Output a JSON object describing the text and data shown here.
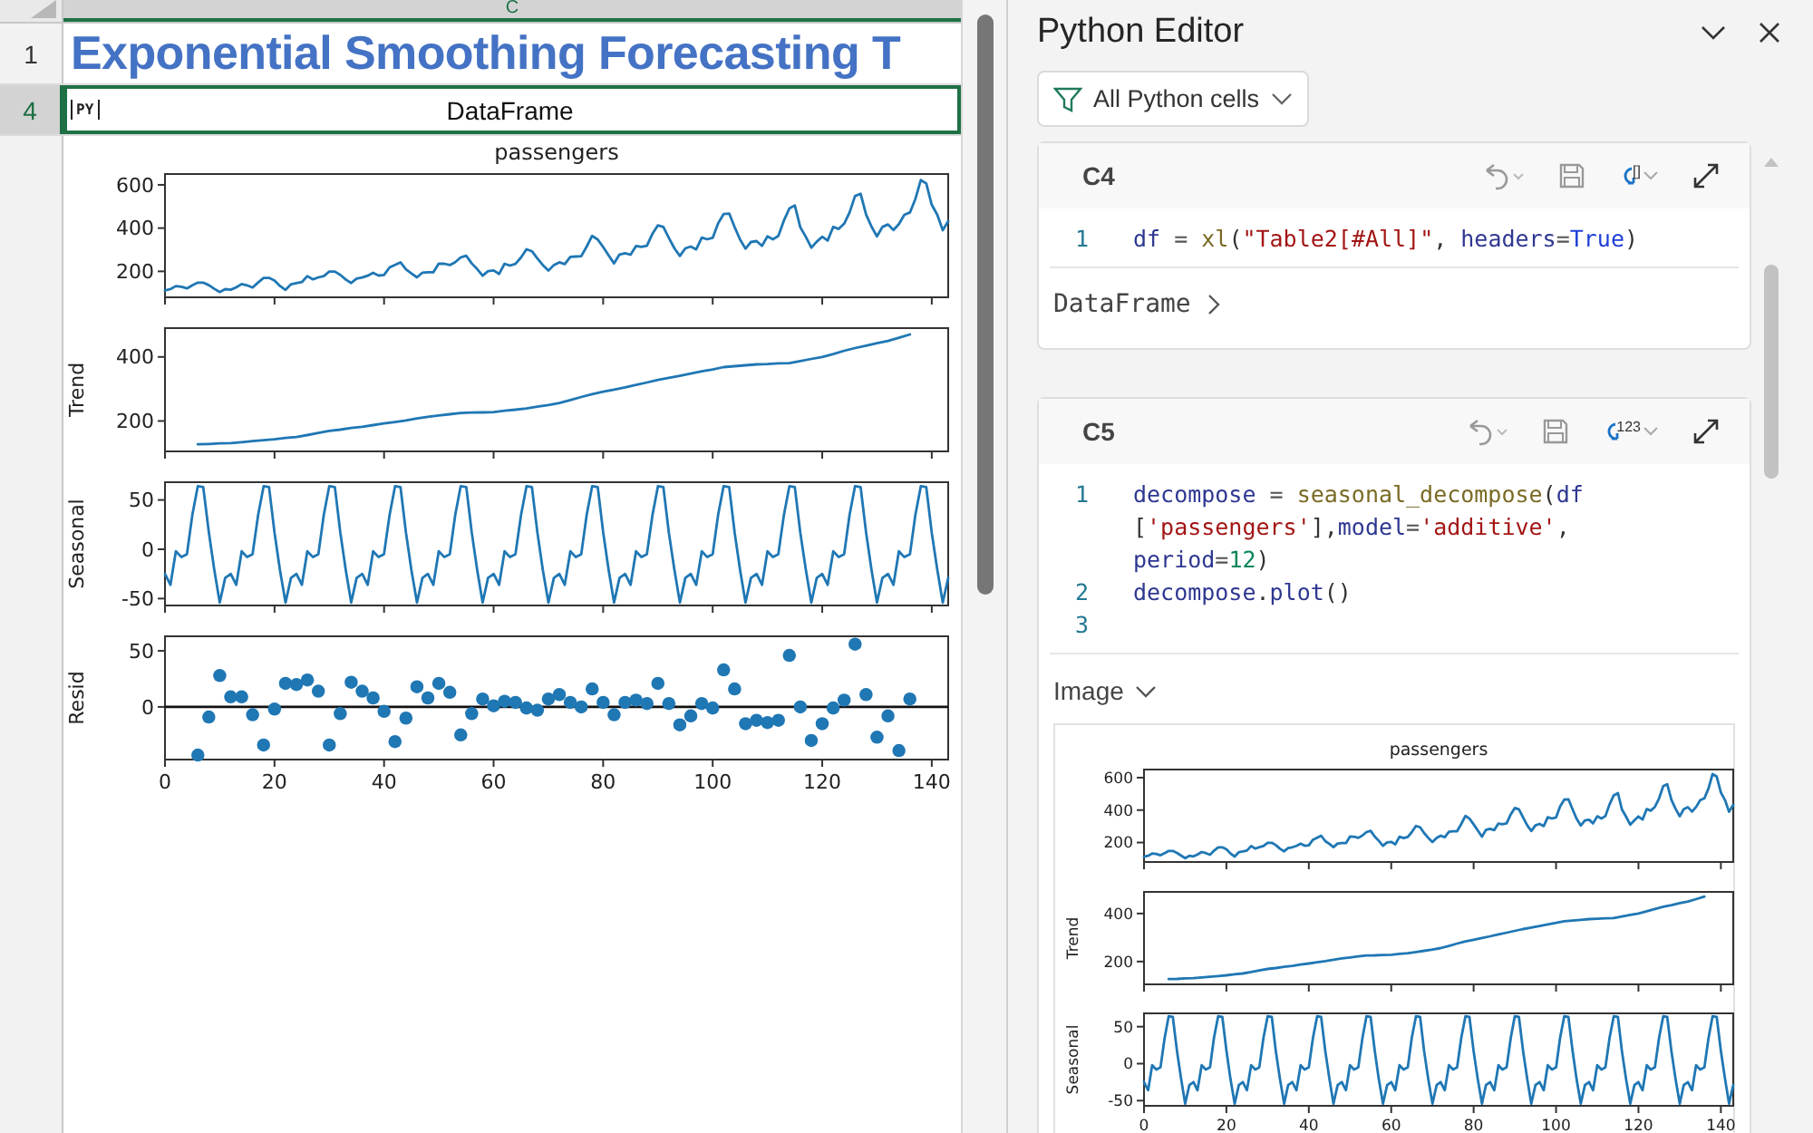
{
  "sheet": {
    "column_header": {
      "label": "C",
      "selected": true
    },
    "rows": [
      {
        "number": "1",
        "selected": false,
        "kind": "title",
        "text": "Exponential Smoothing Forecasting T"
      },
      {
        "number": "4",
        "selected": true,
        "kind": "python",
        "badge": "PY",
        "text": "DataFrame"
      }
    ],
    "plot": [
      {
        "chart_data": {
          "type": "line",
          "title": "passengers",
          "x": [
            0,
            1,
            2,
            3,
            4,
            5,
            6,
            7,
            8,
            9,
            10,
            11,
            12,
            13,
            14,
            15,
            16,
            17,
            18,
            19,
            20,
            21,
            22,
            23,
            24,
            25,
            26,
            27,
            28,
            29,
            30,
            31,
            32,
            33,
            34,
            35,
            36,
            37,
            38,
            39,
            40,
            41,
            42,
            43,
            44,
            45,
            46,
            47,
            48,
            49,
            50,
            51,
            52,
            53,
            54,
            55,
            56,
            57,
            58,
            59,
            60,
            61,
            62,
            63,
            64,
            65,
            66,
            67,
            68,
            69,
            70,
            71,
            72,
            73,
            74,
            75,
            76,
            77,
            78,
            79,
            80,
            81,
            82,
            83,
            84,
            85,
            86,
            87,
            88,
            89,
            90,
            91,
            92,
            93,
            94,
            95,
            96,
            97,
            98,
            99,
            100,
            101,
            102,
            103,
            104,
            105,
            106,
            107,
            108,
            109,
            110,
            111,
            112,
            113,
            114,
            115,
            116,
            117,
            118,
            119,
            120,
            121,
            122,
            123,
            124,
            125,
            126,
            127,
            128,
            129,
            130,
            131,
            132,
            133,
            134,
            135,
            136,
            137,
            138,
            139,
            140,
            141,
            142,
            143
          ],
          "values": [
            112,
            118,
            132,
            129,
            121,
            135,
            148,
            148,
            136,
            119,
            104,
            118,
            115,
            126,
            141,
            135,
            125,
            149,
            170,
            170,
            158,
            133,
            114,
            140,
            145,
            150,
            178,
            163,
            172,
            178,
            199,
            199,
            184,
            162,
            146,
            166,
            171,
            180,
            193,
            181,
            183,
            218,
            230,
            242,
            209,
            191,
            172,
            194,
            196,
            196,
            236,
            235,
            229,
            243,
            264,
            272,
            237,
            211,
            180,
            201,
            204,
            188,
            235,
            227,
            234,
            264,
            302,
            293,
            259,
            229,
            203,
            229,
            242,
            233,
            267,
            269,
            270,
            315,
            364,
            347,
            312,
            274,
            237,
            278,
            284,
            277,
            317,
            313,
            318,
            374,
            413,
            405,
            355,
            306,
            271,
            306,
            315,
            301,
            356,
            348,
            355,
            422,
            465,
            467,
            404,
            347,
            305,
            336,
            340,
            318,
            362,
            348,
            363,
            435,
            491,
            505,
            404,
            359,
            310,
            337,
            360,
            342,
            406,
            396,
            420,
            472,
            548,
            559,
            463,
            407,
            362,
            405,
            417,
            391,
            419,
            461,
            472,
            535,
            622,
            606,
            508,
            461,
            390,
            432
          ],
          "xlim": [
            0,
            143
          ],
          "ylim": [
            80,
            650
          ],
          "yticks": [
            200,
            400,
            600
          ]
        }
      },
      {
        "chart_data": {
          "type": "line",
          "ylabel": "Trend",
          "x": [
            6,
            8,
            10,
            12,
            14,
            16,
            18,
            20,
            22,
            24,
            26,
            28,
            30,
            32,
            34,
            36,
            38,
            40,
            42,
            44,
            46,
            48,
            50,
            52,
            54,
            56,
            58,
            60,
            62,
            64,
            66,
            68,
            70,
            72,
            74,
            76,
            78,
            80,
            82,
            84,
            86,
            88,
            90,
            92,
            94,
            96,
            98,
            100,
            102,
            104,
            106,
            108,
            110,
            112,
            114,
            116,
            118,
            120,
            122,
            124,
            126,
            128,
            130,
            132,
            134,
            136
          ],
          "values": [
            127,
            128,
            130,
            131,
            134,
            137,
            140,
            143,
            147,
            150,
            156,
            163,
            169,
            173,
            178,
            182,
            187,
            192,
            197,
            202,
            208,
            213,
            217,
            221,
            225,
            226,
            227,
            228,
            232,
            235,
            239,
            245,
            250,
            256,
            265,
            275,
            284,
            291,
            298,
            305,
            313,
            320,
            328,
            335,
            341,
            348,
            355,
            361,
            368,
            371,
            374,
            377,
            378,
            380,
            381,
            387,
            394,
            400,
            409,
            419,
            428,
            435,
            443,
            450,
            460,
            470
          ],
          "xlim": [
            0,
            143
          ],
          "ylim": [
            105,
            490
          ],
          "yticks": [
            200,
            400
          ]
        }
      },
      {
        "chart_data": {
          "type": "line",
          "ylabel": "Seasonal",
          "x": [
            0,
            1,
            2,
            3,
            4,
            5,
            6,
            7,
            8,
            9,
            10,
            11,
            12,
            13,
            14,
            15,
            16,
            17,
            18,
            19,
            20,
            21,
            22,
            23,
            24,
            25,
            26,
            27,
            28,
            29,
            30,
            31,
            32,
            33,
            34,
            35,
            36,
            37,
            38,
            39,
            40,
            41,
            42,
            43,
            44,
            45,
            46,
            47,
            48,
            49,
            50,
            51,
            52,
            53,
            54,
            55,
            56,
            57,
            58,
            59,
            60,
            61,
            62,
            63,
            64,
            65,
            66,
            67,
            68,
            69,
            70,
            71,
            72,
            73,
            74,
            75,
            76,
            77,
            78,
            79,
            80,
            81,
            82,
            83,
            84,
            85,
            86,
            87,
            88,
            89,
            90,
            91,
            92,
            93,
            94,
            95,
            96,
            97,
            98,
            99,
            100,
            101,
            102,
            103,
            104,
            105,
            106,
            107,
            108,
            109,
            110,
            111,
            112,
            113,
            114,
            115,
            116,
            117,
            118,
            119,
            120,
            121,
            122,
            123,
            124,
            125,
            126,
            127,
            128,
            129,
            130,
            131,
            132,
            133,
            134,
            135,
            136,
            137,
            138,
            139,
            140,
            141,
            142,
            143
          ],
          "values": [
            -25,
            -36,
            -2,
            -8,
            -5,
            35,
            64,
            63,
            17,
            -21,
            -54,
            -29,
            -25,
            -36,
            -2,
            -8,
            -5,
            35,
            64,
            63,
            17,
            -21,
            -54,
            -29,
            -25,
            -36,
            -2,
            -8,
            -5,
            35,
            64,
            63,
            17,
            -21,
            -54,
            -29,
            -25,
            -36,
            -2,
            -8,
            -5,
            35,
            64,
            63,
            17,
            -21,
            -54,
            -29,
            -25,
            -36,
            -2,
            -8,
            -5,
            35,
            64,
            63,
            17,
            -21,
            -54,
            -29,
            -25,
            -36,
            -2,
            -8,
            -5,
            35,
            64,
            63,
            17,
            -21,
            -54,
            -29,
            -25,
            -36,
            -2,
            -8,
            -5,
            35,
            64,
            63,
            17,
            -21,
            -54,
            -29,
            -25,
            -36,
            -2,
            -8,
            -5,
            35,
            64,
            63,
            17,
            -21,
            -54,
            -29,
            -25,
            -36,
            -2,
            -8,
            -5,
            35,
            64,
            63,
            17,
            -21,
            -54,
            -29,
            -25,
            -36,
            -2,
            -8,
            -5,
            35,
            64,
            63,
            17,
            -21,
            -54,
            -29,
            -25,
            -36,
            -2,
            -8,
            -5,
            35,
            64,
            63,
            17,
            -21,
            -54,
            -29,
            -25,
            -36,
            -2,
            -8,
            -5,
            35,
            64,
            63,
            17,
            -21,
            -54,
            -29
          ],
          "xlim": [
            0,
            143
          ],
          "ylim": [
            -57,
            68
          ],
          "yticks": [
            -50,
            0,
            50
          ]
        }
      },
      {
        "chart_data": {
          "type": "scatter",
          "ylabel": "Resid",
          "x": [
            6,
            8,
            10,
            12,
            14,
            16,
            18,
            20,
            22,
            24,
            26,
            28,
            30,
            32,
            34,
            36,
            38,
            40,
            42,
            44,
            46,
            48,
            50,
            52,
            54,
            56,
            58,
            60,
            62,
            64,
            66,
            68,
            70,
            72,
            74,
            76,
            78,
            80,
            82,
            84,
            86,
            88,
            90,
            92,
            94,
            96,
            98,
            100,
            102,
            104,
            106,
            108,
            110,
            112,
            114,
            116,
            118,
            120,
            122,
            124,
            126,
            128,
            130,
            132,
            134,
            136
          ],
          "values": [
            -43,
            -9,
            28,
            9,
            9,
            -7,
            -34,
            -2,
            21,
            20,
            24,
            14,
            -34,
            -6,
            22,
            14,
            8,
            -4,
            -31,
            -10,
            18,
            8,
            21,
            13,
            -25,
            -6,
            7,
            1,
            5,
            4,
            -1,
            -3,
            7,
            11,
            4,
            0,
            16,
            4,
            -7,
            4,
            6,
            3,
            21,
            3,
            -16,
            -8,
            3,
            -1,
            33,
            16,
            -15,
            -12,
            -14,
            -12,
            46,
            0,
            -30,
            -15,
            -1,
            6,
            56,
            11,
            -27,
            -8,
            -39,
            7
          ],
          "xlim": [
            0,
            143
          ],
          "ylim": [
            -47,
            63
          ],
          "xticks": [
            0,
            20,
            40,
            60,
            80,
            100,
            120,
            140
          ],
          "yticks": [
            0,
            50
          ],
          "ref_lines": [
            {
              "axis": "y",
              "value": 0
            }
          ]
        }
      }
    ]
  },
  "editor": {
    "title": "Python Editor",
    "filter": {
      "label": "All Python cells"
    },
    "cells": [
      {
        "ref": "C4",
        "return_mark": "[]",
        "lines": [
          {
            "number": "1",
            "rows": [
              {
                "tokens": [
                  {
                    "kind": "name",
                    "text": "df"
                  },
                  {
                    "kind": "op",
                    "text": " = "
                  },
                  {
                    "kind": "func",
                    "text": "xl"
                  },
                  {
                    "kind": "punc",
                    "text": "("
                  },
                  {
                    "kind": "str",
                    "text": "\"Table2[#All]\""
                  },
                  {
                    "kind": "punc",
                    "text": ", "
                  },
                  {
                    "kind": "name",
                    "text": "headers"
                  },
                  {
                    "kind": "op",
                    "text": "="
                  },
                  {
                    "kind": "kw",
                    "text": "True"
                  },
                  {
                    "kind": "punc",
                    "text": ")"
                  }
                ]
              }
            ]
          }
        ],
        "output": {
          "label": "DataFrame",
          "expanded": false
        }
      },
      {
        "ref": "C5",
        "return_mark": "123",
        "lines": [
          {
            "number": "1",
            "rows": [
              {
                "tokens": [
                  {
                    "kind": "name",
                    "text": "decompose"
                  },
                  {
                    "kind": "op",
                    "text": " = "
                  },
                  {
                    "kind": "func",
                    "text": "seasonal_decompose"
                  },
                  {
                    "kind": "punc",
                    "text": "("
                  },
                  {
                    "kind": "name",
                    "text": "df"
                  }
                ]
              },
              {
                "tokens": [
                  {
                    "kind": "punc",
                    "text": "["
                  },
                  {
                    "kind": "str",
                    "text": "'passengers'"
                  },
                  {
                    "kind": "punc",
                    "text": "],"
                  },
                  {
                    "kind": "name",
                    "text": "model"
                  },
                  {
                    "kind": "op",
                    "text": "="
                  },
                  {
                    "kind": "str",
                    "text": "'additive'"
                  },
                  {
                    "kind": "punc",
                    "text": ","
                  }
                ]
              },
              {
                "tokens": [
                  {
                    "kind": "name",
                    "text": "period"
                  },
                  {
                    "kind": "op",
                    "text": "="
                  },
                  {
                    "kind": "num",
                    "text": "12"
                  },
                  {
                    "kind": "punc",
                    "text": ")"
                  }
                ]
              }
            ]
          },
          {
            "number": "2",
            "rows": [
              {
                "tokens": [
                  {
                    "kind": "name",
                    "text": "decompose"
                  },
                  {
                    "kind": "punc",
                    "text": "."
                  },
                  {
                    "kind": "name",
                    "text": "plot"
                  },
                  {
                    "kind": "punc",
                    "text": "()"
                  }
                ]
              }
            ]
          },
          {
            "number": "3"
          }
        ],
        "output": {
          "label": "Image",
          "expanded": true,
          "plot": [
            {
              "chart_data": {
                "type": "line",
                "title": "passengers",
                "x": [
                  0,
                  1,
                  2,
                  3,
                  4,
                  5,
                  6,
                  7,
                  8,
                  9,
                  10,
                  11,
                  12,
                  13,
                  14,
                  15,
                  16,
                  17,
                  18,
                  19,
                  20,
                  21,
                  22,
                  23,
                  24,
                  25,
                  26,
                  27,
                  28,
                  29,
                  30,
                  31,
                  32,
                  33,
                  34,
                  35,
                  36,
                  37,
                  38,
                  39,
                  40,
                  41,
                  42,
                  43,
                  44,
                  45,
                  46,
                  47,
                  48,
                  49,
                  50,
                  51,
                  52,
                  53,
                  54,
                  55,
                  56,
                  57,
                  58,
                  59,
                  60,
                  61,
                  62,
                  63,
                  64,
                  65,
                  66,
                  67,
                  68,
                  69,
                  70,
                  71,
                  72,
                  73,
                  74,
                  75,
                  76,
                  77,
                  78,
                  79,
                  80,
                  81,
                  82,
                  83,
                  84,
                  85,
                  86,
                  87,
                  88,
                  89,
                  90,
                  91,
                  92,
                  93,
                  94,
                  95,
                  96,
                  97,
                  98,
                  99,
                  100,
                  101,
                  102,
                  103,
                  104,
                  105,
                  106,
                  107,
                  108,
                  109,
                  110,
                  111,
                  112,
                  113,
                  114,
                  115,
                  116,
                  117,
                  118,
                  119,
                  120,
                  121,
                  122,
                  123,
                  124,
                  125,
                  126,
                  127,
                  128,
                  129,
                  130,
                  131,
                  132,
                  133,
                  134,
                  135,
                  136,
                  137,
                  138,
                  139,
                  140,
                  141,
                  142,
                  143
                ],
                "values": [
                  112,
                  118,
                  132,
                  129,
                  121,
                  135,
                  148,
                  148,
                  136,
                  119,
                  104,
                  118,
                  115,
                  126,
                  141,
                  135,
                  125,
                  149,
                  170,
                  170,
                  158,
                  133,
                  114,
                  140,
                  145,
                  150,
                  178,
                  163,
                  172,
                  178,
                  199,
                  199,
                  184,
                  162,
                  146,
                  166,
                  171,
                  180,
                  193,
                  181,
                  183,
                  218,
                  230,
                  242,
                  209,
                  191,
                  172,
                  194,
                  196,
                  196,
                  236,
                  235,
                  229,
                  243,
                  264,
                  272,
                  237,
                  211,
                  180,
                  201,
                  204,
                  188,
                  235,
                  227,
                  234,
                  264,
                  302,
                  293,
                  259,
                  229,
                  203,
                  229,
                  242,
                  233,
                  267,
                  269,
                  270,
                  315,
                  364,
                  347,
                  312,
                  274,
                  237,
                  278,
                  284,
                  277,
                  317,
                  313,
                  318,
                  374,
                  413,
                  405,
                  355,
                  306,
                  271,
                  306,
                  315,
                  301,
                  356,
                  348,
                  355,
                  422,
                  465,
                  467,
                  404,
                  347,
                  305,
                  336,
                  340,
                  318,
                  362,
                  348,
                  363,
                  435,
                  491,
                  505,
                  404,
                  359,
                  310,
                  337,
                  360,
                  342,
                  406,
                  396,
                  420,
                  472,
                  548,
                  559,
                  463,
                  407,
                  362,
                  405,
                  417,
                  391,
                  419,
                  461,
                  472,
                  535,
                  622,
                  606,
                  508,
                  461,
                  390,
                  432
                ],
                "xlim": [
                  0,
                  143
                ],
                "ylim": [
                  80,
                  650
                ],
                "yticks": [
                  200,
                  400,
                  600
                ]
              }
            },
            {
              "chart_data": {
                "type": "line",
                "ylabel": "Trend",
                "x": [
                  6,
                  8,
                  10,
                  12,
                  14,
                  16,
                  18,
                  20,
                  22,
                  24,
                  26,
                  28,
                  30,
                  32,
                  34,
                  36,
                  38,
                  40,
                  42,
                  44,
                  46,
                  48,
                  50,
                  52,
                  54,
                  56,
                  58,
                  60,
                  62,
                  64,
                  66,
                  68,
                  70,
                  72,
                  74,
                  76,
                  78,
                  80,
                  82,
                  84,
                  86,
                  88,
                  90,
                  92,
                  94,
                  96,
                  98,
                  100,
                  102,
                  104,
                  106,
                  108,
                  110,
                  112,
                  114,
                  116,
                  118,
                  120,
                  122,
                  124,
                  126,
                  128,
                  130,
                  132,
                  134,
                  136
                ],
                "values": [
                  127,
                  128,
                  130,
                  131,
                  134,
                  137,
                  140,
                  143,
                  147,
                  150,
                  156,
                  163,
                  169,
                  173,
                  178,
                  182,
                  187,
                  192,
                  197,
                  202,
                  208,
                  213,
                  217,
                  221,
                  225,
                  226,
                  227,
                  228,
                  232,
                  235,
                  239,
                  245,
                  250,
                  256,
                  265,
                  275,
                  284,
                  291,
                  298,
                  305,
                  313,
                  320,
                  328,
                  335,
                  341,
                  348,
                  355,
                  361,
                  368,
                  371,
                  374,
                  377,
                  378,
                  380,
                  381,
                  387,
                  394,
                  400,
                  409,
                  419,
                  428,
                  435,
                  443,
                  450,
                  460,
                  470
                ],
                "xlim": [
                  0,
                  143
                ],
                "ylim": [
                  105,
                  490
                ],
                "yticks": [
                  200,
                  400
                ]
              }
            },
            {
              "chart_data": {
                "type": "line",
                "ylabel": "Seasonal",
                "x": [
                  0,
                  1,
                  2,
                  3,
                  4,
                  5,
                  6,
                  7,
                  8,
                  9,
                  10,
                  11,
                  12,
                  13,
                  14,
                  15,
                  16,
                  17,
                  18,
                  19,
                  20,
                  21,
                  22,
                  23,
                  24,
                  25,
                  26,
                  27,
                  28,
                  29,
                  30,
                  31,
                  32,
                  33,
                  34,
                  35,
                  36,
                  37,
                  38,
                  39,
                  40,
                  41,
                  42,
                  43,
                  44,
                  45,
                  46,
                  47,
                  48,
                  49,
                  50,
                  51,
                  52,
                  53,
                  54,
                  55,
                  56,
                  57,
                  58,
                  59,
                  60,
                  61,
                  62,
                  63,
                  64,
                  65,
                  66,
                  67,
                  68,
                  69,
                  70,
                  71,
                  72,
                  73,
                  74,
                  75,
                  76,
                  77,
                  78,
                  79,
                  80,
                  81,
                  82,
                  83,
                  84,
                  85,
                  86,
                  87,
                  88,
                  89,
                  90,
                  91,
                  92,
                  93,
                  94,
                  95,
                  96,
                  97,
                  98,
                  99,
                  100,
                  101,
                  102,
                  103,
                  104,
                  105,
                  106,
                  107,
                  108,
                  109,
                  110,
                  111,
                  112,
                  113,
                  114,
                  115,
                  116,
                  117,
                  118,
                  119,
                  120,
                  121,
                  122,
                  123,
                  124,
                  125,
                  126,
                  127,
                  128,
                  129,
                  130,
                  131,
                  132,
                  133,
                  134,
                  135,
                  136,
                  137,
                  138,
                  139,
                  140,
                  141,
                  142,
                  143
                ],
                "values": [
                  -25,
                  -36,
                  -2,
                  -8,
                  -5,
                  35,
                  64,
                  63,
                  17,
                  -21,
                  -54,
                  -29,
                  -25,
                  -36,
                  -2,
                  -8,
                  -5,
                  35,
                  64,
                  63,
                  17,
                  -21,
                  -54,
                  -29,
                  -25,
                  -36,
                  -2,
                  -8,
                  -5,
                  35,
                  64,
                  63,
                  17,
                  -21,
                  -54,
                  -29,
                  -25,
                  -36,
                  -2,
                  -8,
                  -5,
                  35,
                  64,
                  63,
                  17,
                  -21,
                  -54,
                  -29,
                  -25,
                  -36,
                  -2,
                  -8,
                  -5,
                  35,
                  64,
                  63,
                  17,
                  -21,
                  -54,
                  -29,
                  -25,
                  -36,
                  -2,
                  -8,
                  -5,
                  35,
                  64,
                  63,
                  17,
                  -21,
                  -54,
                  -29,
                  -25,
                  -36,
                  -2,
                  -8,
                  -5,
                  35,
                  64,
                  63,
                  17,
                  -21,
                  -54,
                  -29,
                  -25,
                  -36,
                  -2,
                  -8,
                  -5,
                  35,
                  64,
                  63,
                  17,
                  -21,
                  -54,
                  -29,
                  -25,
                  -36,
                  -2,
                  -8,
                  -5,
                  35,
                  64,
                  63,
                  17,
                  -21,
                  -54,
                  -29,
                  -25,
                  -36,
                  -2,
                  -8,
                  -5,
                  35,
                  64,
                  63,
                  17,
                  -21,
                  -54,
                  -29,
                  -25,
                  -36,
                  -2,
                  -8,
                  -5,
                  35,
                  64,
                  63,
                  17,
                  -21,
                  -54,
                  -29,
                  -25,
                  -36,
                  -2,
                  -8,
                  -5,
                  35,
                  64,
                  63,
                  17,
                  -21,
                  -54,
                  -29
                ],
                "xlim": [
                  0,
                  143
                ],
                "ylim": [
                  -57,
                  68
                ],
                "yticks": [
                  -50,
                  0,
                  50
                ],
                "xticks": [
                  0,
                  20,
                  40,
                  60,
                  80,
                  100,
                  120,
                  140
                ]
              }
            }
          ]
        }
      }
    ]
  }
}
